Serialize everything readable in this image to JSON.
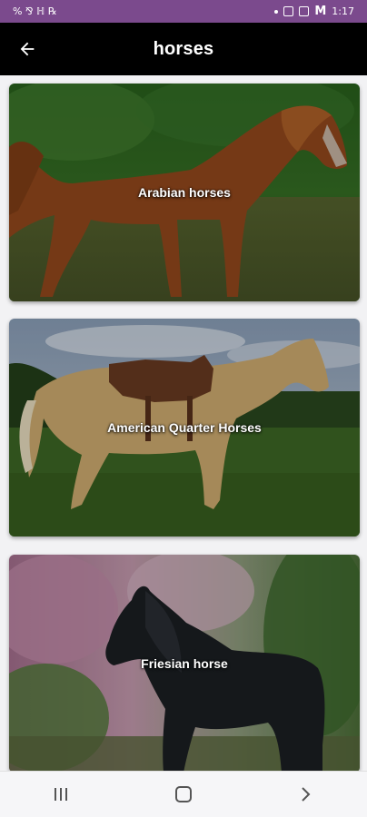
{
  "status_bar": {
    "left_text": "% ⅋ ℍ ℞",
    "right_m": "M",
    "time": "1:17",
    "background_color": "#7b4a8d"
  },
  "app_bar": {
    "title": "horses",
    "back_icon": "arrow-left-icon",
    "background_color": "#000000"
  },
  "cards": [
    {
      "label": "Arabian horses",
      "image": "chestnut-arabian-horse-photo"
    },
    {
      "label": "American Quarter Horses",
      "image": "palomino-horse-with-saddle-photo"
    },
    {
      "label": "Friesian horse",
      "image": "black-friesian-horse-photo"
    }
  ],
  "nav_bar": {
    "recents_icon": "recents-icon",
    "home_icon": "home-icon",
    "back_icon": "chevron-right-icon"
  }
}
